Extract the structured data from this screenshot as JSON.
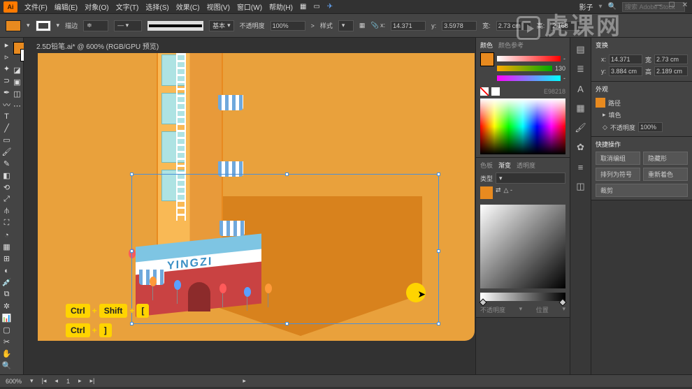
{
  "app": {
    "logo": "Ai"
  },
  "menu": {
    "file": "文件(F)",
    "edit": "编辑(E)",
    "object": "对象(O)",
    "type": "文字(T)",
    "select": "选择(S)",
    "effect": "效果(C)",
    "view": "视图(V)",
    "window": "窗口(W)",
    "help": "帮助(H)"
  },
  "topright": {
    "label": "影子",
    "search_placeholder": "搜索 Adobe Stock"
  },
  "control": {
    "fill_label": "填色",
    "stroke_label": "描边",
    "stroke_weight": "",
    "style_label": "基本",
    "opacity_label": "不透明度",
    "opacity": "100%",
    "style2": "样式",
    "x": "14.371",
    "y": "3.5978",
    "w": "2.73 cm",
    "h": "2.168"
  },
  "doc": {
    "tab": "2.5D铅笔.ai* @ 600% (RGB/GPU 预览)"
  },
  "artwork": {
    "sign": "YINGZI"
  },
  "shortcuts": {
    "ctrl": "Ctrl",
    "shift": "Shift",
    "plus": "+",
    "bracket_open": "[",
    "bracket_close": "]"
  },
  "statusbar": {
    "zoom": "600%"
  },
  "panels": {
    "color": {
      "tab1": "颜色",
      "tab2": "颜色参考",
      "hex_label": "E98218",
      "val": "130"
    },
    "swatches": {
      "tab1": "色板",
      "tab2": "渐变",
      "tab3": "透明度",
      "type": "类型"
    },
    "gradient": {
      "opacity": "不透明度",
      "position": "位置"
    },
    "transform": {
      "title": "变换",
      "x_label": "x:",
      "y_label": "y:",
      "w_label": "宽:",
      "h_label": "高:",
      "x": "14.371",
      "xu": "2.73 cm",
      "y": "3.884 cm",
      "yu": "2.189 cm"
    },
    "appearance": {
      "title": "外观",
      "path": "路径",
      "fill": "填色",
      "opacity_label": "不透明度",
      "opacity": "100%"
    },
    "actions": {
      "title": "快捷操作",
      "b1": "取消编组",
      "b2": "隐藏形",
      "b3": "排列为符号",
      "b4": "重新着色",
      "b5": "裁剪"
    }
  },
  "watermark": "虎课网"
}
